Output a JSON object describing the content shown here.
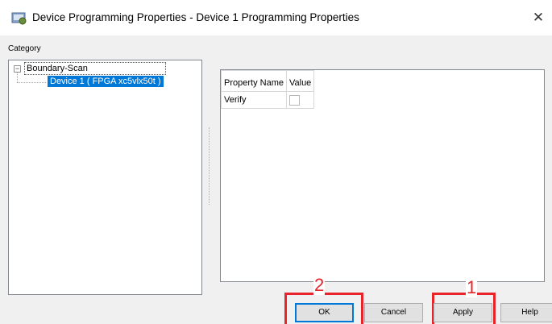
{
  "window": {
    "title": "Device Programming Properties - Device 1 Programming Properties",
    "close_symbol": "✕"
  },
  "category": {
    "label": "Category",
    "tree": {
      "expander": "⊟",
      "root": "Boundary-Scan",
      "selected_child": "Device 1 ( FPGA xc5vlx50t )"
    }
  },
  "properties": {
    "headers": [
      "Property Name",
      "Value"
    ],
    "rows": [
      {
        "name": "Verify",
        "value_type": "checkbox",
        "checked": false
      }
    ]
  },
  "buttons": {
    "ok": "OK",
    "cancel": "Cancel",
    "apply": "Apply",
    "help": "Help"
  },
  "annotations": {
    "ok_step": "2",
    "apply_step": "1",
    "color": "#e8232a"
  },
  "colors": {
    "selection": "#0078d7",
    "dialog_bg": "#f0f0f0"
  }
}
